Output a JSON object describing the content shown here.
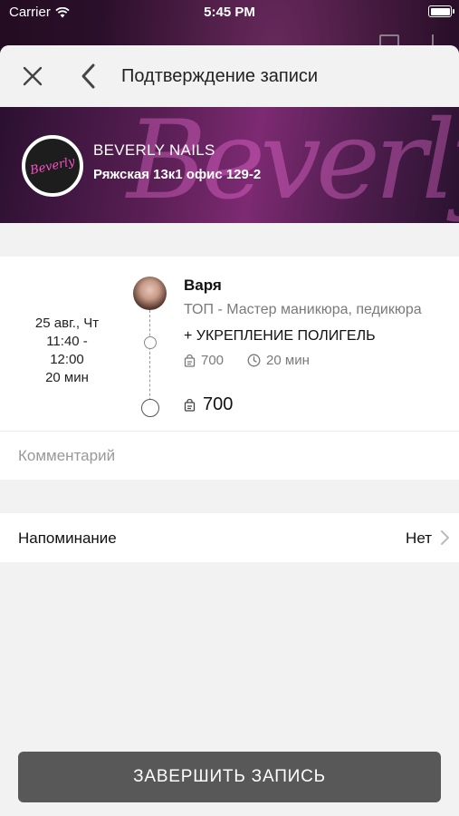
{
  "status_bar": {
    "carrier": "Carrier",
    "time": "5:45 PM"
  },
  "nav": {
    "title": "Подтверждение записи"
  },
  "salon": {
    "name": "BEVERLY NAILS",
    "address": "Ряжская 13к1 офис 129-2",
    "logo_text": "Beverly",
    "banner_text": "Beverly"
  },
  "appointment": {
    "date": "25 авг., Чт",
    "time_range": "11:40 -",
    "time_end": "12:00",
    "duration": "20 мин",
    "master_name": "Варя",
    "master_role": "ТОП - Мастер маникюра, педикюра",
    "service_name": "+ УКРЕПЛЕНИЕ ПОЛИГЕЛЬ",
    "service_price": "700",
    "service_duration": "20 мин",
    "total_price": "700"
  },
  "comment": {
    "placeholder": "Комментарий"
  },
  "reminder": {
    "label": "Напоминание",
    "value": "Нет"
  },
  "finish_button": {
    "label": "ЗАВЕРШИТЬ ЗАПИСЬ"
  },
  "colors": {
    "button_bg": "#585858",
    "sheet_bg": "#f2f2f2"
  }
}
